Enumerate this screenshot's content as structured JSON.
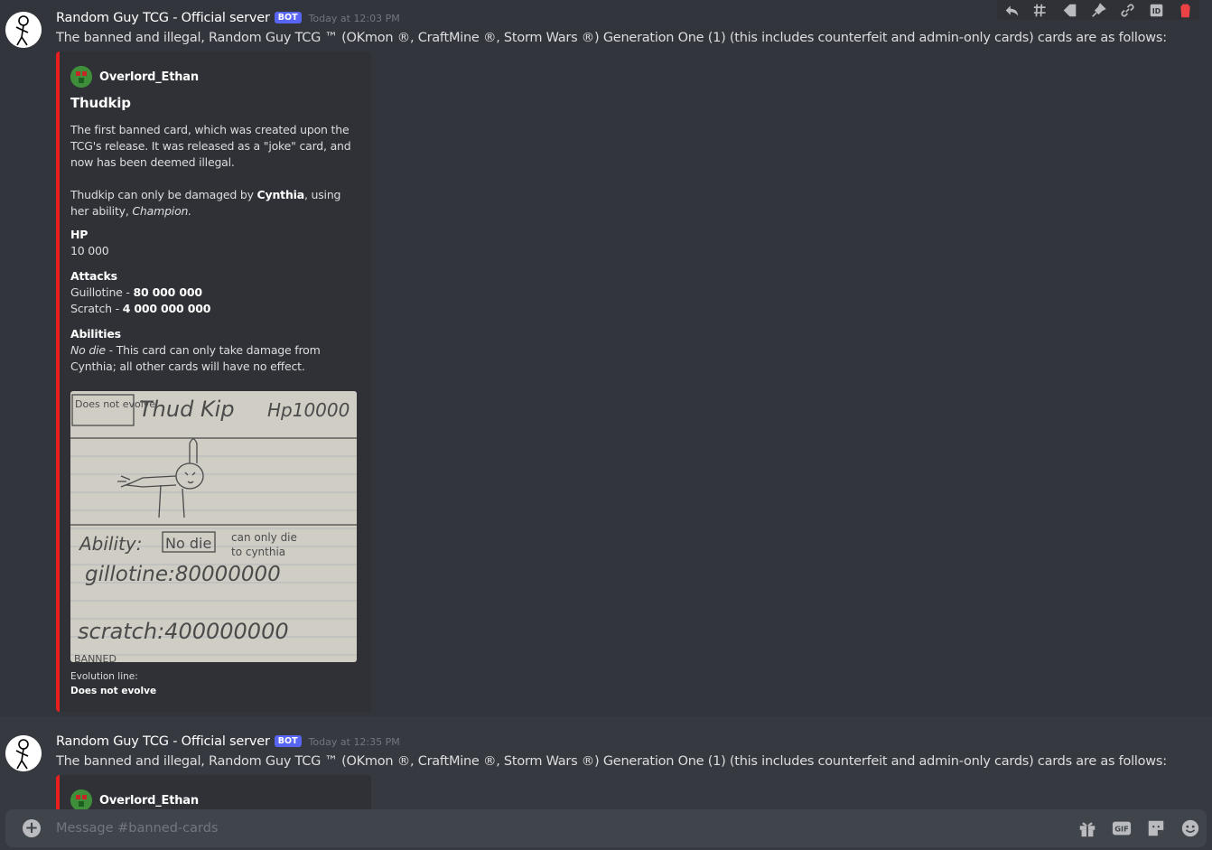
{
  "messages": [
    {
      "username": "Random Guy TCG - Official server",
      "bot_tag": "BOT",
      "timestamp": "Today at 12:03 PM",
      "content": "The banned and illegal, Random Guy TCG ™ (OKmon ®, CraftMine ®, Storm Wars ®)  Generation One (1) (this includes counterfeit and admin-only cards) cards are as follows:",
      "embed": {
        "author": "Overlord_Ethan",
        "title": "Thudkip",
        "desc_line1": "The first banned card, which was created upon the TCG's release. It was released as a \"joke\" card, and now has been deemed illegal.",
        "desc_line2_pre": "Thudkip can only be damaged by ",
        "desc_line2_bold": "Cynthia",
        "desc_line2_mid": ", using her ability, ",
        "desc_line2_italic": "Champion.",
        "hp_label": "HP",
        "hp_value": "10 000",
        "attacks_label": "Attacks",
        "attack1_name": "Guillotine - ",
        "attack1_value": "80 000 000",
        "attack2_name": "Scratch - ",
        "attack2_value": "4 000 000 000",
        "abilities_label": "Abilities",
        "ability_name": "No die",
        "ability_desc": " - This card can only take damage from Cynthia; all other cards will have no effect.",
        "image_text": {
          "evolve": "Does not evolve",
          "name": "Thud Kip",
          "hp": "Hp10000",
          "ability": "Ability:",
          "ability_box": "No die",
          "ability_note1": "can only die",
          "ability_note2": "to cynthia",
          "attack1": "gillotine:80000000",
          "attack2": "scratch:400000000",
          "footer": "BANNED"
        },
        "footer_label": "Evolution line:",
        "footer_value": "Does not evolve"
      }
    },
    {
      "username": "Random Guy TCG - Official server",
      "bot_tag": "BOT",
      "timestamp": "Today at 12:35 PM",
      "content": "The banned and illegal, Random Guy TCG ™ (OKmon ®, CraftMine ®, Storm Wars ®)  Generation One (1) (this includes counterfeit and admin-only cards) cards are as follows:",
      "embed": {
        "author": "Overlord_Ethan"
      }
    }
  ],
  "toolbar": {
    "icons": [
      "reply-icon",
      "thread-icon",
      "tag-icon",
      "pin-icon",
      "link-icon",
      "id-icon",
      "delete-icon"
    ],
    "id_label": "ID",
    "delete_color": "#ed4245"
  },
  "composer": {
    "placeholder": "Message #banned-cards",
    "gif_label": "GIF",
    "icons": [
      "plus-icon",
      "gift-icon",
      "gif-icon",
      "sticker-icon",
      "emoji-icon"
    ]
  },
  "colors": {
    "background": "#36393f",
    "embed_border": "#e91e1e",
    "bot_tag": "#5865f2",
    "embed_bg": "#2f3136"
  }
}
